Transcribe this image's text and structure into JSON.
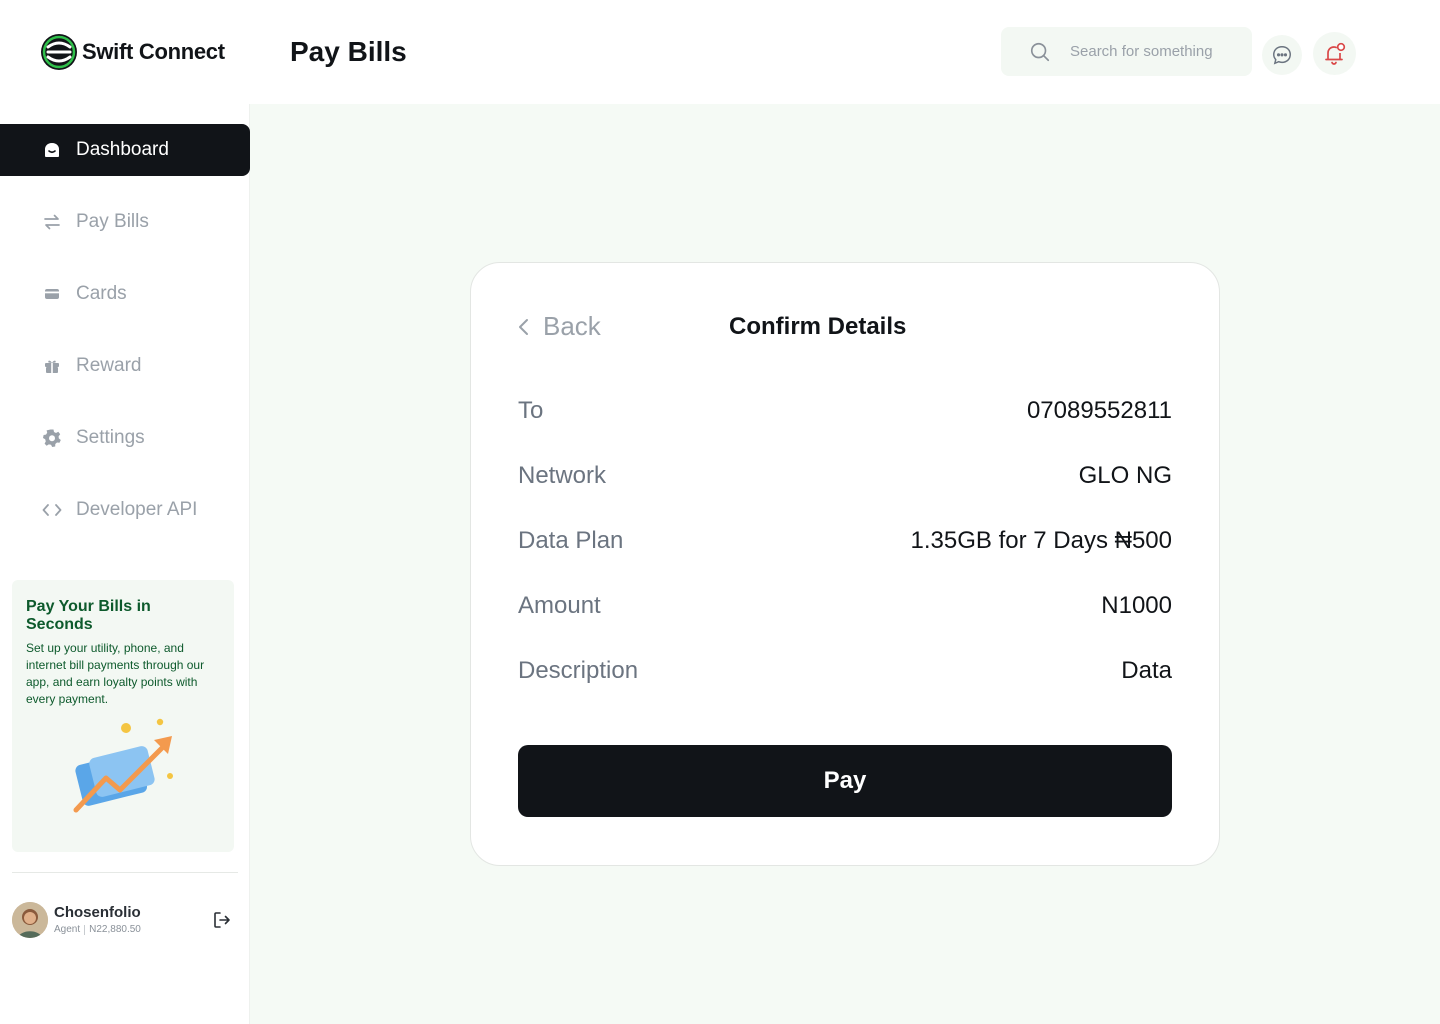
{
  "app": {
    "name": "Swift Connect"
  },
  "header": {
    "title": "Pay Bills",
    "search_placeholder": "Search for something",
    "icons": [
      "search-icon",
      "chat-icon",
      "bell-icon"
    ]
  },
  "sidebar": {
    "items": [
      {
        "label": "Dashboard",
        "icon": "home-icon",
        "active": true
      },
      {
        "label": "Pay Bills",
        "icon": "transfer-icon",
        "active": false
      },
      {
        "label": "Cards",
        "icon": "card-icon",
        "active": false
      },
      {
        "label": "Reward",
        "icon": "gift-icon",
        "active": false
      },
      {
        "label": "Settings",
        "icon": "gear-icon",
        "active": false
      },
      {
        "label": "Developer API",
        "icon": "code-icon",
        "active": false
      }
    ],
    "promo": {
      "title": "Pay Your Bills in Seconds",
      "text": "Set up your utility, phone, and internet bill payments through our app, and earn loyalty points with every payment."
    },
    "user": {
      "name": "Chosenfolio",
      "role": "Agent",
      "balance": "N22,880.50"
    }
  },
  "confirm": {
    "back_label": "Back",
    "title": "Confirm Details",
    "rows": [
      {
        "label": "To",
        "value": "07089552811"
      },
      {
        "label": "Network",
        "value": "GLO NG"
      },
      {
        "label": "Data Plan",
        "value": "1.35GB for 7 Days ₦500"
      },
      {
        "label": "Amount",
        "value": "N1000"
      },
      {
        "label": "Description",
        "value": "Data"
      }
    ],
    "pay_label": "Pay"
  },
  "colors": {
    "brand_dark": "#111418",
    "accent_green": "#0d5a2c",
    "background_tint": "#f5faf5",
    "bell_red": "#d94848"
  }
}
